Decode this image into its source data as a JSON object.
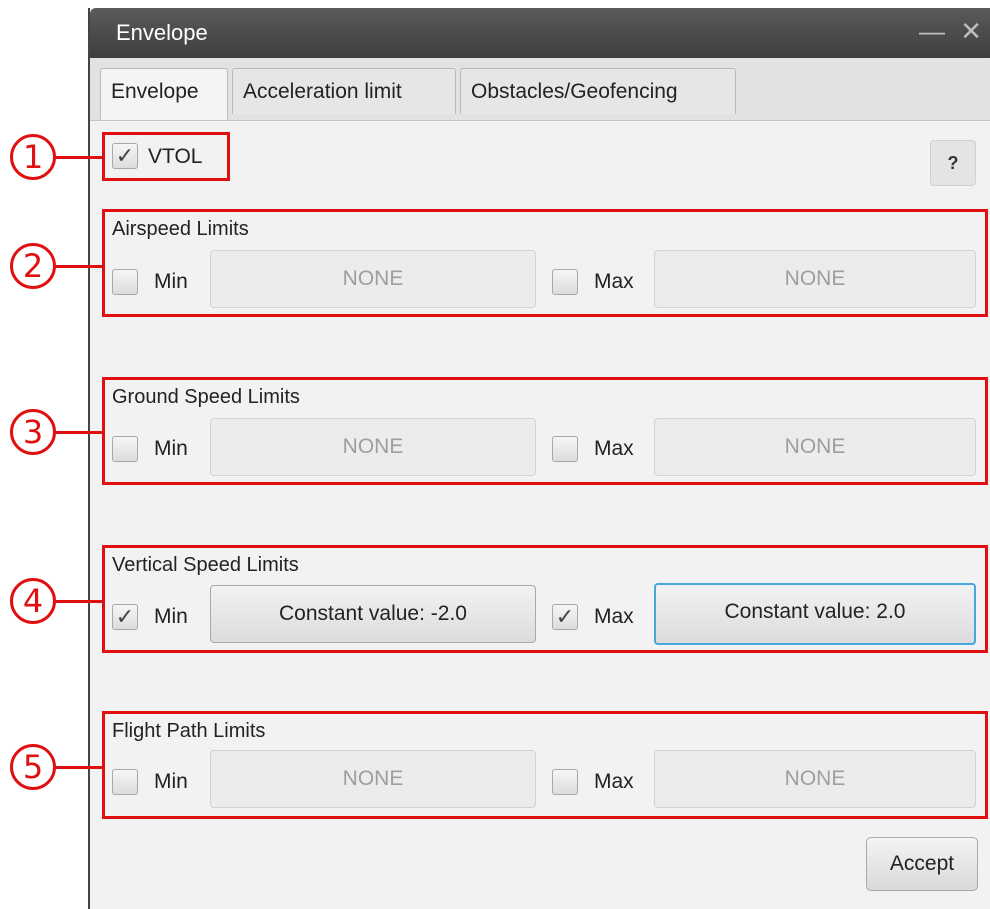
{
  "window": {
    "title": "Envelope",
    "minimize_glyph": "—",
    "close_glyph": "✕"
  },
  "tabs": [
    {
      "label": "Envelope",
      "active": true
    },
    {
      "label": "Acceleration limit",
      "active": false
    },
    {
      "label": "Obstacles/Geofencing",
      "active": false
    }
  ],
  "vtol": {
    "label": "VTOL",
    "checked": true
  },
  "help_label": "?",
  "callouts": [
    "1",
    "2",
    "3",
    "4",
    "5"
  ],
  "groups": [
    {
      "title": "Airspeed Limits",
      "min": {
        "label": "Min",
        "checked": false,
        "value": "NONE"
      },
      "max": {
        "label": "Max",
        "checked": false,
        "value": "NONE"
      }
    },
    {
      "title": "Ground Speed Limits",
      "min": {
        "label": "Min",
        "checked": false,
        "value": "NONE"
      },
      "max": {
        "label": "Max",
        "checked": false,
        "value": "NONE"
      }
    },
    {
      "title": "Vertical Speed Limits",
      "min": {
        "label": "Min",
        "checked": true,
        "value": "Constant value: -2.0"
      },
      "max": {
        "label": "Max",
        "checked": true,
        "value": "Constant value: 2.0"
      }
    },
    {
      "title": "Flight Path Limits",
      "min": {
        "label": "Min",
        "checked": false,
        "value": "NONE"
      },
      "max": {
        "label": "Max",
        "checked": false,
        "value": "NONE"
      }
    }
  ],
  "accept_label": "Accept",
  "check_glyph": "✓",
  "colors": {
    "annotation": "#e01010",
    "focus": "#46a6df",
    "titlebar": "#4a4a4a"
  }
}
